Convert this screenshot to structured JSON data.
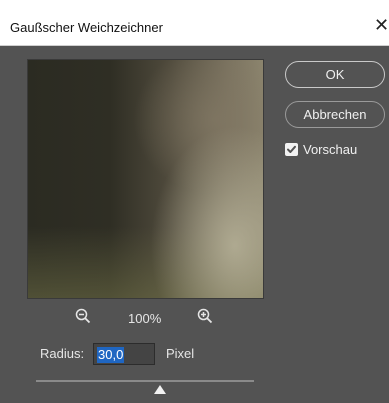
{
  "window": {
    "title": "Gaußscher Weichzeichner",
    "close_icon": "close-icon"
  },
  "buttons": {
    "ok_label": "OK",
    "cancel_label": "Abbrechen"
  },
  "preview_option": {
    "label": "Vorschau",
    "checked": true
  },
  "zoom": {
    "level": "100%",
    "zoom_out_icon": "zoom-out-icon",
    "zoom_in_icon": "zoom-in-icon"
  },
  "radius": {
    "label": "Radius:",
    "value": "30,0",
    "unit": "Pixel"
  },
  "colors": {
    "dialog_bg": "#535353",
    "selection": "#1f66c2"
  }
}
